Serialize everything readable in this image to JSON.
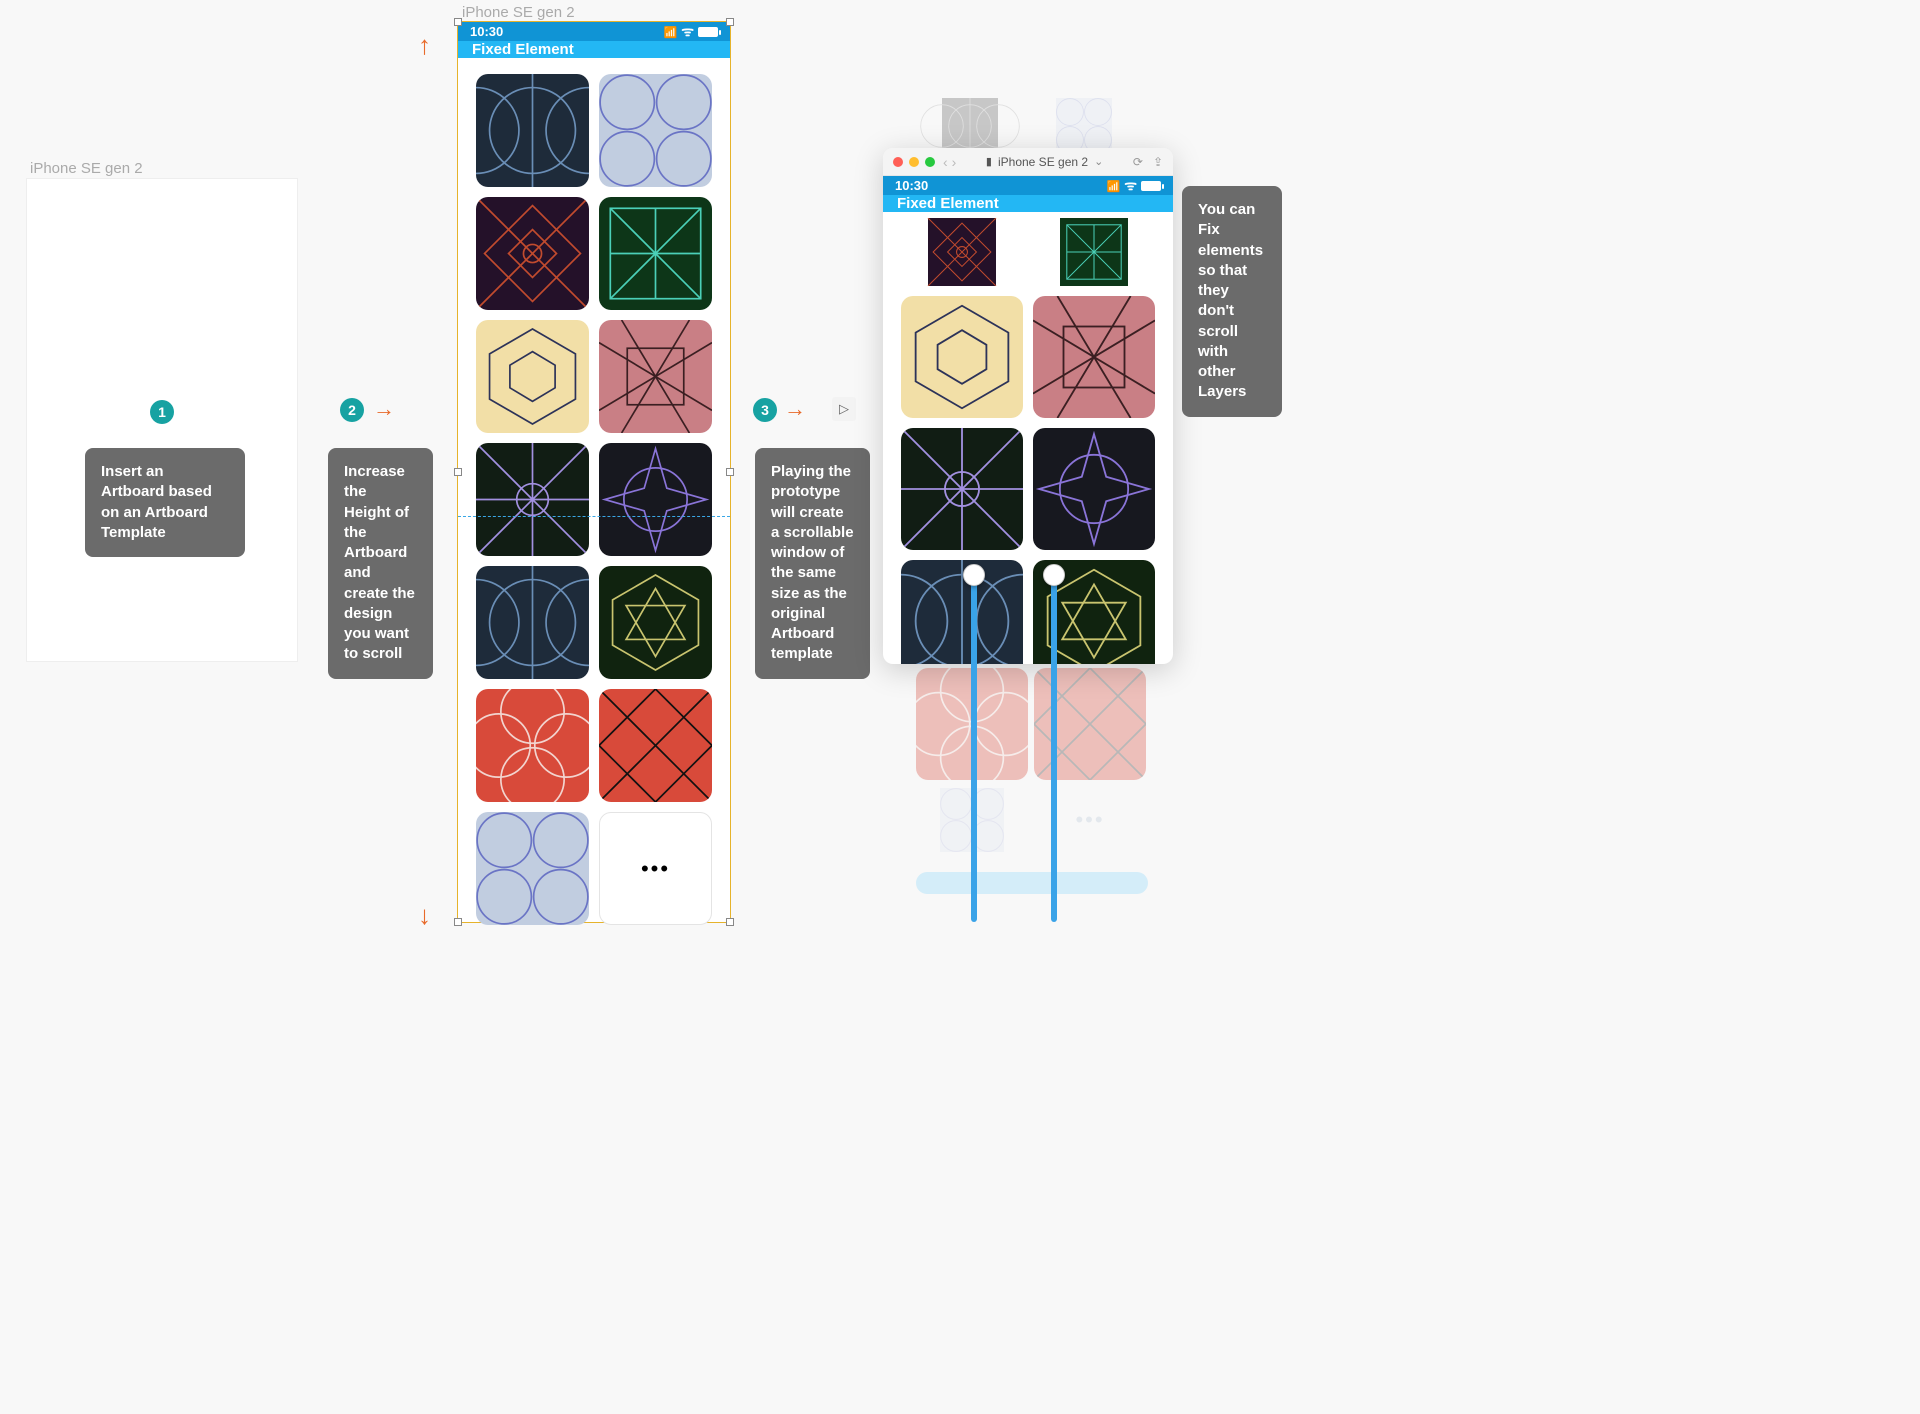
{
  "labels": {
    "artboard1": "iPhone SE gen 2",
    "artboard2": "iPhone SE gen 2",
    "preview_device": "iPhone SE gen 2"
  },
  "status": {
    "time": "10:30"
  },
  "fixed_bar": "Fixed Element",
  "badges": {
    "b1": "1",
    "b2": "2",
    "b3": "3"
  },
  "tips": {
    "t1": "Insert an Artboard based on an Artboard Template",
    "t2": "Increase the Height of the Artboard and create the design you want to scroll",
    "t3": "Playing the prototype will create a scrollable window of the same size as the original Artboard template",
    "t4": "You can Fix elements so that they don't scroll with other Layers"
  },
  "play_icon": "▷",
  "more_icon": "•••",
  "titlebar": {
    "back": "‹",
    "fwd": "›",
    "refresh": "⟳",
    "share": "⇪"
  },
  "tiles": [
    {
      "bg": "#1e2b3a",
      "stroke": "#6a8eb6",
      "pattern": "circles"
    },
    {
      "bg": "#c1cde0",
      "stroke": "#6a74c5",
      "pattern": "rings"
    },
    {
      "bg": "#241129",
      "stroke": "#c14b2e",
      "pattern": "diamond"
    },
    {
      "bg": "#0d3618",
      "stroke": "#4bd0b8",
      "pattern": "grid"
    },
    {
      "bg": "#f2dfa7",
      "stroke": "#2d3359",
      "pattern": "hex"
    },
    {
      "bg": "#c97f85",
      "stroke": "#3b1f22",
      "pattern": "weave"
    },
    {
      "bg": "#111d14",
      "stroke": "#a290e0",
      "pattern": "radial"
    },
    {
      "bg": "#17181f",
      "stroke": "#8a74d8",
      "pattern": "star"
    },
    {
      "bg": "#1e2b3a",
      "stroke": "#6a8eb6",
      "pattern": "circles"
    },
    {
      "bg": "#10230f",
      "stroke": "#c9c46f",
      "pattern": "hexstar"
    },
    {
      "bg": "#d84a3a",
      "stroke": "#f2d4cf",
      "pattern": "petals"
    },
    {
      "bg": "#d84a3a",
      "stroke": "#111",
      "pattern": "cross"
    },
    {
      "bg": "#c1cde0",
      "stroke": "#6a74c5",
      "pattern": "rings"
    }
  ],
  "preview_tiles": [
    {
      "bg": "#241129",
      "stroke": "#c14b2e",
      "pattern": "diamond"
    },
    {
      "bg": "#0d3618",
      "stroke": "#4bd0b8",
      "pattern": "grid"
    },
    {
      "bg": "#f2dfa7",
      "stroke": "#2d3359",
      "pattern": "hex"
    },
    {
      "bg": "#c97f85",
      "stroke": "#3b1f22",
      "pattern": "weave"
    },
    {
      "bg": "#111d14",
      "stroke": "#a290e0",
      "pattern": "radial"
    },
    {
      "bg": "#17181f",
      "stroke": "#8a74d8",
      "pattern": "star"
    },
    {
      "bg": "#1e2b3a",
      "stroke": "#6a8eb6",
      "pattern": "circles"
    },
    {
      "bg": "#10230f",
      "stroke": "#c9c46f",
      "pattern": "hexstar"
    }
  ],
  "ghosts": {
    "a": {
      "bg": "#5a5a5a",
      "stroke": "#aaa",
      "pattern": "circles"
    },
    "b": {
      "bg": "#dbe3ef",
      "stroke": "#9fa7d8",
      "pattern": "rings"
    },
    "c": {
      "bg": "#d84a3a",
      "stroke": "#f2d4cf",
      "pattern": "petals"
    },
    "d": {
      "bg": "#d84a3a",
      "stroke": "#333",
      "pattern": "cross"
    },
    "e": {
      "bg": "#d6deeb",
      "stroke": "#9fa7d8",
      "pattern": "rings"
    }
  }
}
